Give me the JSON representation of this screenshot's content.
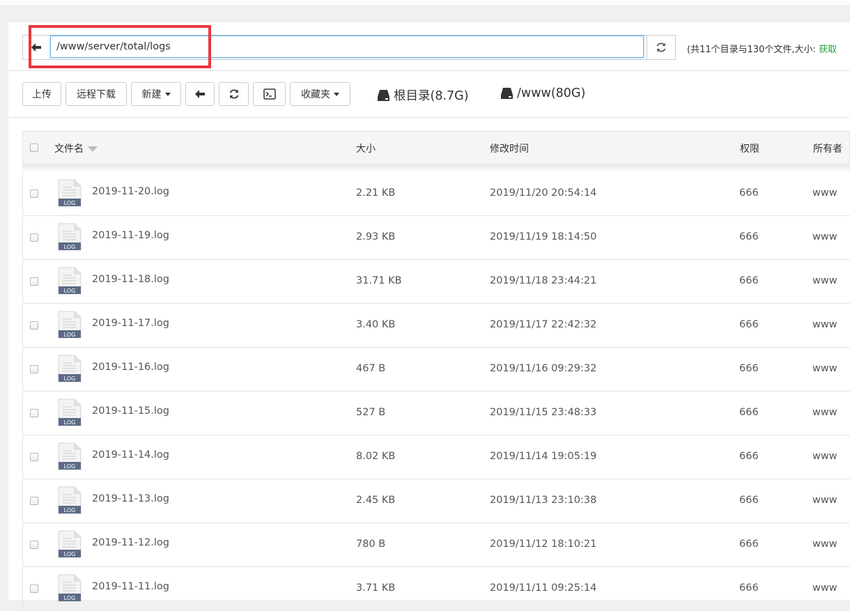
{
  "path": {
    "back_label": "←",
    "value": "/www/server/total/logs"
  },
  "summary": {
    "text": "(共11个目录与130个文件,大小: ",
    "link": "获取"
  },
  "toolbar": {
    "upload": "上传",
    "remote_download": "远程下载",
    "new": "新建",
    "favorites": "收藏夹",
    "disks": [
      {
        "label": "根目录(8.7G)"
      },
      {
        "label": "/www(80G)"
      }
    ]
  },
  "table": {
    "headers": {
      "name": "文件名",
      "size": "大小",
      "mtime": "修改时间",
      "perm": "权限",
      "owner": "所有者"
    },
    "icon_badge": "LOG",
    "rows": [
      {
        "name": "2019-11-20.log",
        "size": "2.21 KB",
        "mtime": "2019/11/20 20:54:14",
        "perm": "666",
        "owner": "www"
      },
      {
        "name": "2019-11-19.log",
        "size": "2.93 KB",
        "mtime": "2019/11/19 18:14:50",
        "perm": "666",
        "owner": "www"
      },
      {
        "name": "2019-11-18.log",
        "size": "31.71 KB",
        "mtime": "2019/11/18 23:44:21",
        "perm": "666",
        "owner": "www"
      },
      {
        "name": "2019-11-17.log",
        "size": "3.40 KB",
        "mtime": "2019/11/17 22:42:32",
        "perm": "666",
        "owner": "www"
      },
      {
        "name": "2019-11-16.log",
        "size": "467 B",
        "mtime": "2019/11/16 09:29:32",
        "perm": "666",
        "owner": "www"
      },
      {
        "name": "2019-11-15.log",
        "size": "527 B",
        "mtime": "2019/11/15 23:48:33",
        "perm": "666",
        "owner": "www"
      },
      {
        "name": "2019-11-14.log",
        "size": "8.02 KB",
        "mtime": "2019/11/14 19:05:19",
        "perm": "666",
        "owner": "www"
      },
      {
        "name": "2019-11-13.log",
        "size": "2.45 KB",
        "mtime": "2019/11/13 23:10:38",
        "perm": "666",
        "owner": "www"
      },
      {
        "name": "2019-11-12.log",
        "size": "780 B",
        "mtime": "2019/11/12 18:10:21",
        "perm": "666",
        "owner": "www"
      },
      {
        "name": "2019-11-11.log",
        "size": "3.71 KB",
        "mtime": "2019/11/11 09:25:14",
        "perm": "666",
        "owner": "www"
      }
    ]
  },
  "colors": {
    "highlight": "#e8383d",
    "link_green": "#20a53a",
    "input_focus": "#66afe9"
  }
}
